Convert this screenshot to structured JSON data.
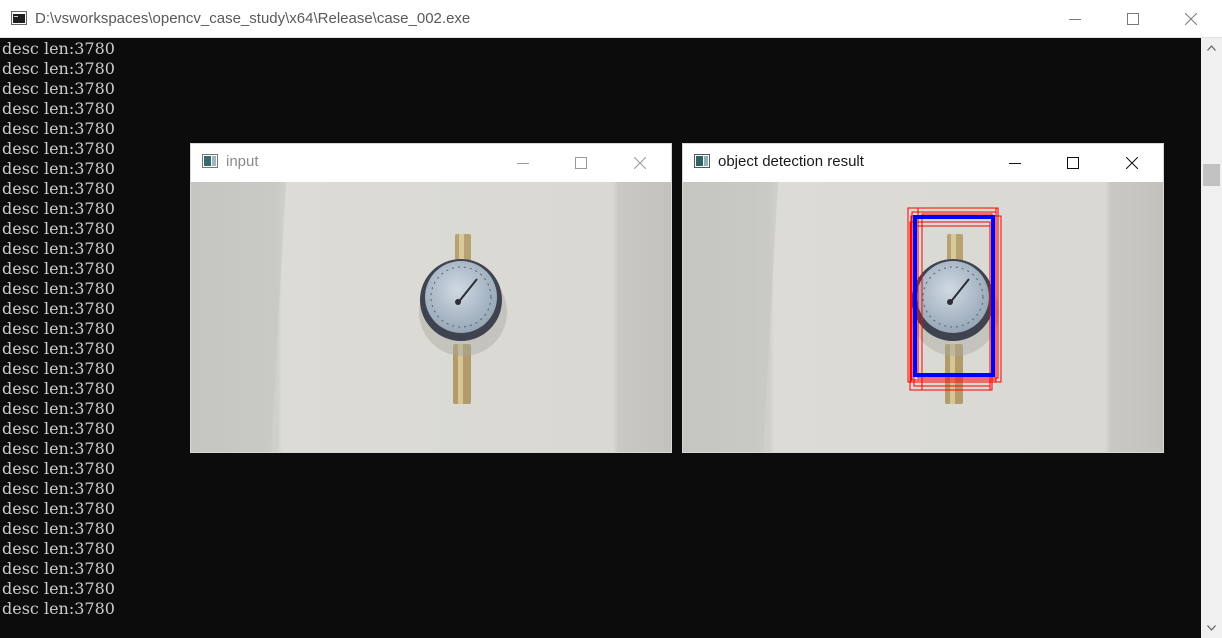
{
  "window": {
    "title": "D:\\vsworkspaces\\opencv_case_study\\x64\\Release\\case_002.exe",
    "icon": "console-app-icon",
    "controls": [
      "minimize-icon",
      "maximize-icon",
      "close-icon"
    ]
  },
  "console": {
    "lines": [
      "desc len:3780",
      "desc len:3780",
      "desc len:3780",
      "desc len:3780",
      "desc len:3780",
      "desc len:3780",
      "desc len:3780",
      "desc len:3780",
      "desc len:3780",
      "desc len:3780",
      "desc len:3780",
      "desc len:3780",
      "desc len:3780",
      "desc len:3780",
      "desc len:3780",
      "desc len:3780",
      "desc len:3780",
      "desc len:3780",
      "desc len:3780",
      "desc len:3780",
      "desc len:3780",
      "desc len:3780",
      "desc len:3780",
      "desc len:3780",
      "desc len:3780",
      "desc len:3780",
      "desc len:3780",
      "desc len:3780",
      "desc len:3780"
    ]
  },
  "input_window": {
    "title": "input",
    "title_color": "#8a8a8a"
  },
  "result_window": {
    "title": "object detection result",
    "title_color": "#1a1a1a"
  },
  "colors": {
    "console_bg": "#0c0c0c",
    "console_text": "#cccccc",
    "detection_box": "#0000ff",
    "candidate_box": "#ff0000"
  }
}
